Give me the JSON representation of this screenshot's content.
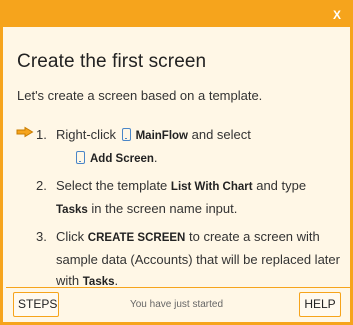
{
  "window": {
    "close_label": "X"
  },
  "content": {
    "title": "Create the first screen",
    "intro": "Let's create a screen based on a template.",
    "steps": [
      {
        "num": "1.",
        "pre": "Right-click",
        "target": "MainFlow",
        "mid": "and select",
        "action": "Add Screen",
        "post": "."
      },
      {
        "num": "2.",
        "pre": "Select the template",
        "template": "List With Chart",
        "mid": "and type",
        "name": "Tasks",
        "post": "in the screen name input."
      },
      {
        "num": "3.",
        "pre": "Click",
        "button": "CREATE SCREEN",
        "mid": "to create a screen with sample data (Accounts) that will be replaced later with",
        "name": "Tasks",
        "post": "."
      }
    ]
  },
  "footer": {
    "steps_label": "STEPS",
    "status": "You have just started",
    "help_label": "HELP"
  },
  "colors": {
    "accent": "#f6a41c",
    "background": "#fff7e6",
    "icon": "#4a86c8"
  }
}
